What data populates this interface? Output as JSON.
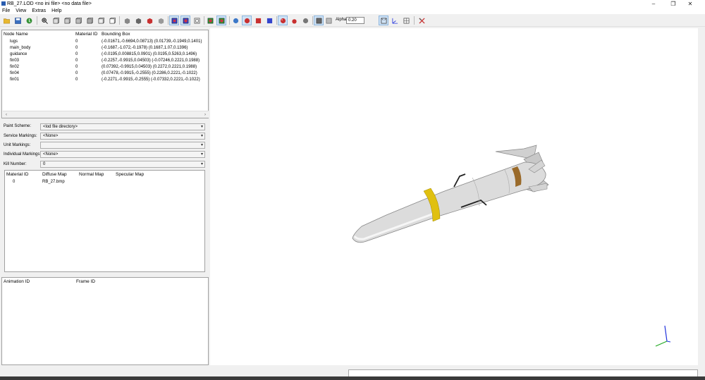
{
  "window": {
    "title": "RB_27.LOD  <no ini file>  <no data file>",
    "minimize_glyph": "–",
    "maximize_glyph": "❐",
    "close_glyph": "✕"
  },
  "menu": [
    "File",
    "View",
    "Extras",
    "Help"
  ],
  "toolbar": {
    "alpha_label": "Alpha",
    "alpha_value": "0.20"
  },
  "nodes": {
    "headers": [
      "Node Name",
      "Material ID",
      "Bounding Box"
    ],
    "rows": [
      {
        "name": "lugs",
        "material": "0",
        "bbox": "(-0.01671,-0.6694,0.08713) (0.01739,-0.1949,0.1401)"
      },
      {
        "name": "main_body",
        "material": "0",
        "bbox": "(-0.1687,-1.072,-0.1978) (0.1687,1.07,0.1396)"
      },
      {
        "name": "guidance",
        "material": "0",
        "bbox": "(-0.0195,0.008815,0.0901) (0.0195,0.5263,0.1496)"
      },
      {
        "name": "fin03",
        "material": "0",
        "bbox": "(-0.2257,-0.9915,0.04503) (-0.07246,0.2221,0.1988)"
      },
      {
        "name": "fin02",
        "material": "0",
        "bbox": "(0.07392,-0.9915,0.04503) (0.2272,0.2221,0.1988)"
      },
      {
        "name": "fin04",
        "material": "0",
        "bbox": "(0.07478,-0.9915,-0.2555) (0.2286,0.2221,-0.1022)"
      },
      {
        "name": "fin01",
        "material": "0",
        "bbox": "(-0.2271,-0.9915,-0.2555) (-0.07332,0.2221,-0.1022)"
      }
    ]
  },
  "scroll": {
    "left": "‹",
    "right": "›"
  },
  "markings": {
    "paint_scheme_label": "Paint Scheme:",
    "paint_scheme_value": "<lod file directory>",
    "service_label": "Service Markings:",
    "service_value": "<None>",
    "unit_label": "Unit Markings:",
    "unit_value": "",
    "individual_label": "Individual Markings:",
    "individual_value": "<None>",
    "kill_label": "Kill Number:",
    "kill_value": "0",
    "dropdown_glyph": "▾"
  },
  "materials": {
    "headers": [
      "Material ID",
      "Diffuse Map",
      "Normal Map",
      "Specular Map"
    ],
    "rows": [
      {
        "id": "0",
        "diffuse": "RB_27.bmp",
        "normal": "",
        "specular": ""
      }
    ]
  },
  "animations": {
    "headers": [
      "Animation ID",
      "Frame ID"
    ]
  },
  "colors": {
    "missile_body": "#dcdcdc",
    "missile_stripe_yellow": "#e0c010",
    "missile_stripe_brown": "#9a6a2a",
    "axis_blue": "#2233dd",
    "axis_green": "#22aa22"
  }
}
